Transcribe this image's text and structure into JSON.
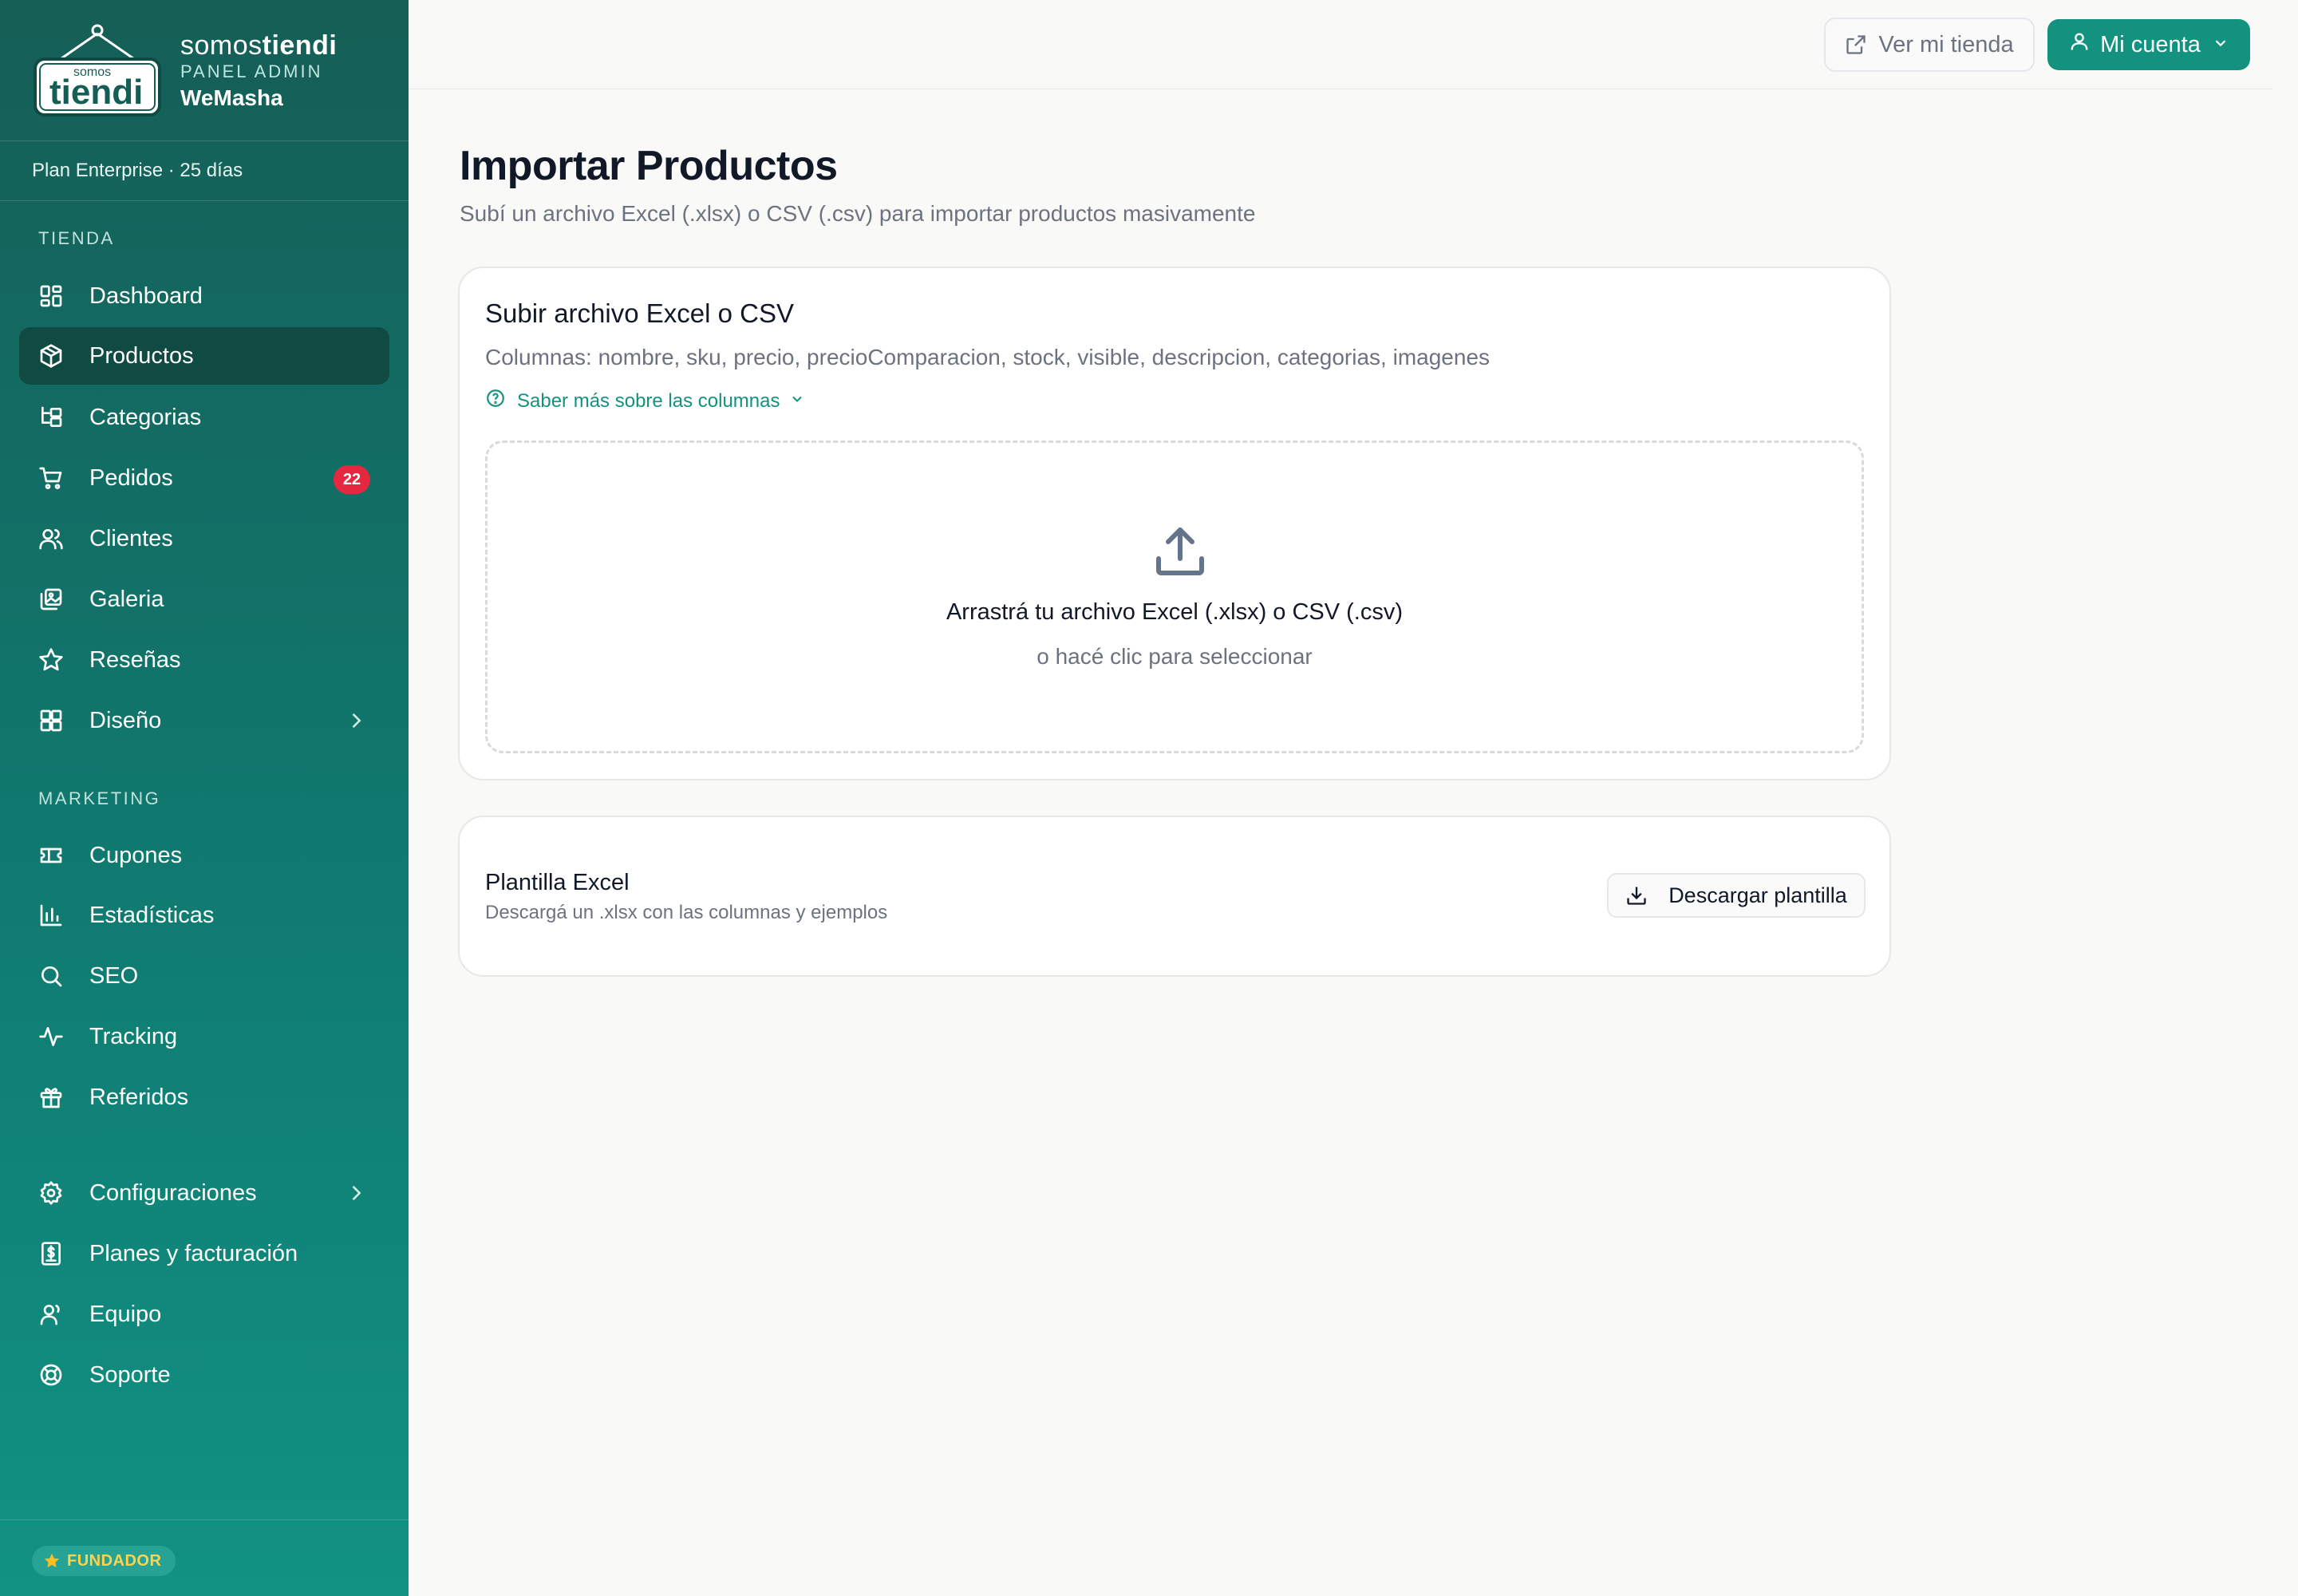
{
  "brand": {
    "logo_text_top": "somos",
    "logo_text_main": "tiendi",
    "name_light": "somos",
    "name_bold": "tiendi",
    "subtitle": "PANEL ADMIN",
    "store": "WeMasha"
  },
  "plan": "Plan Enterprise · 25 días",
  "sidebar": {
    "section_tienda": "TIENDA",
    "section_marketing": "MARKETING",
    "items": [
      {
        "label": "Dashboard",
        "icon": "grid-icon"
      },
      {
        "label": "Productos",
        "icon": "package-icon",
        "active": true
      },
      {
        "label": "Categorias",
        "icon": "tree-icon"
      },
      {
        "label": "Pedidos",
        "icon": "cart-icon",
        "badge": "22"
      },
      {
        "label": "Clientes",
        "icon": "users-icon"
      },
      {
        "label": "Galeria",
        "icon": "images-icon"
      },
      {
        "label": "Reseñas",
        "icon": "star-icon"
      },
      {
        "label": "Diseño",
        "icon": "layout-icon",
        "has_submenu": true
      },
      {
        "label": "Cupones",
        "icon": "ticket-icon"
      },
      {
        "label": "Estadísticas",
        "icon": "chart-icon"
      },
      {
        "label": "SEO",
        "icon": "search-icon"
      },
      {
        "label": "Tracking",
        "icon": "activity-icon"
      },
      {
        "label": "Referidos",
        "icon": "gift-icon"
      },
      {
        "label": "Configuraciones",
        "icon": "gear-icon",
        "has_submenu": true
      },
      {
        "label": "Planes y facturación",
        "icon": "receipt-icon"
      },
      {
        "label": "Equipo",
        "icon": "user-icon"
      },
      {
        "label": "Soporte",
        "icon": "lifebuoy-icon"
      }
    ],
    "founder_badge": "FUNDADOR"
  },
  "topbar": {
    "view_store_label": "Ver mi tienda",
    "account_label": "Mi cuenta"
  },
  "main": {
    "title": "Importar Productos",
    "subtitle": "Subí un archivo Excel (.xlsx) o CSV (.csv) para importar productos masivamente",
    "upload_card": {
      "title": "Subir archivo Excel o CSV",
      "columns": "Columnas: nombre, sku, precio, precioComparacion, stock, visible, descripcion, categorias, imagenes",
      "learn_more": "Saber más sobre las columnas",
      "drop_main": "Arrastrá tu archivo Excel (.xlsx) o CSV (.csv)",
      "drop_sub": "o hacé clic para seleccionar"
    },
    "template_card": {
      "title": "Plantilla Excel",
      "subtitle": "Descargá un .xlsx con las columnas y ejemplos",
      "download_label": "Descargar plantilla"
    }
  },
  "colors": {
    "accent": "#13927f",
    "sidebar_top": "#155e56",
    "sidebar_bottom": "#119283",
    "badge": "#e5283f"
  }
}
